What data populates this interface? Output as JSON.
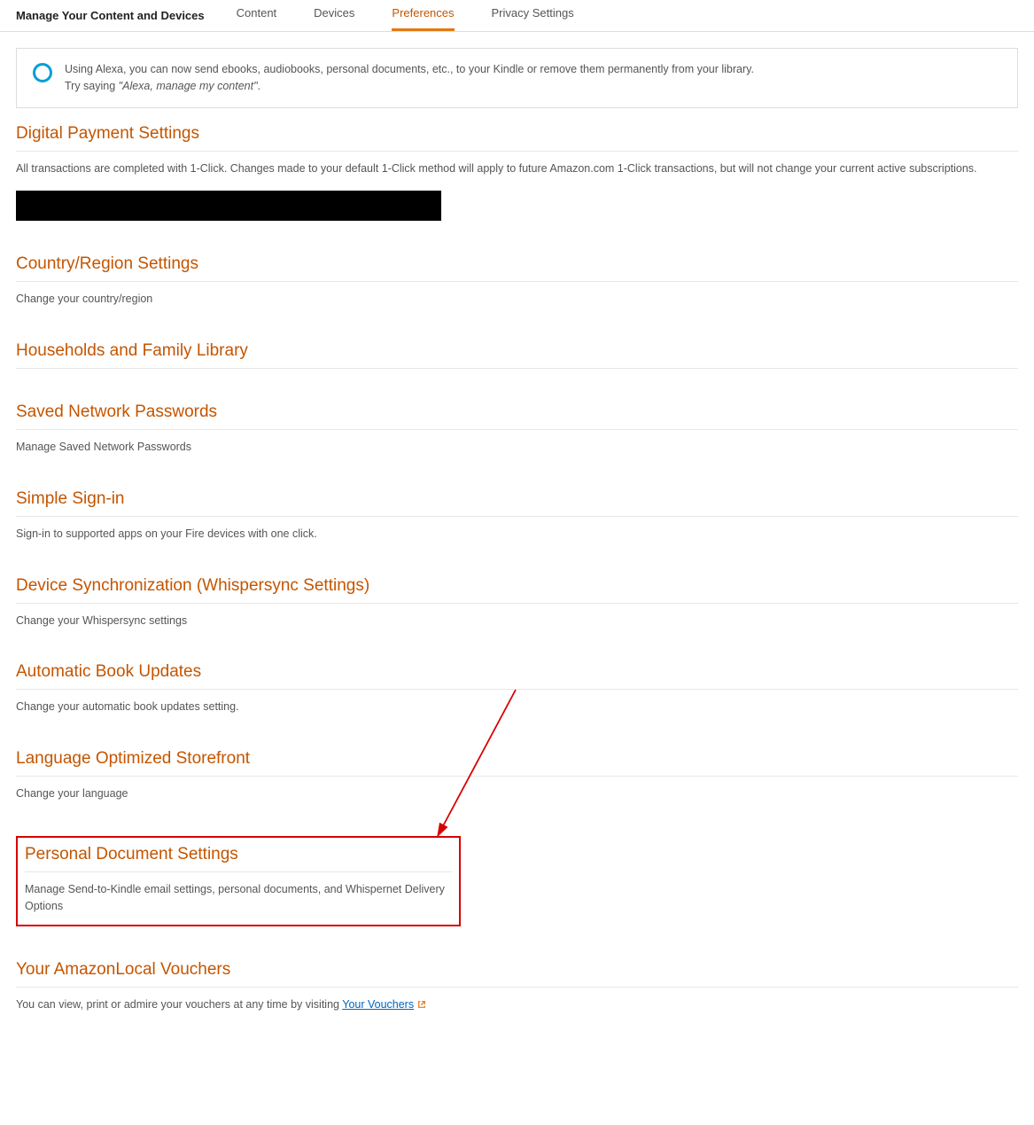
{
  "header": {
    "title": "Manage Your Content and Devices",
    "tabs": [
      {
        "label": "Content",
        "active": false
      },
      {
        "label": "Devices",
        "active": false
      },
      {
        "label": "Preferences",
        "active": true
      },
      {
        "label": "Privacy Settings",
        "active": false
      }
    ]
  },
  "alexa_banner": {
    "line1": "Using Alexa, you can now send ebooks, audiobooks, personal documents, etc., to your Kindle or remove them permanently from your library.",
    "line2a": "Try saying ",
    "line2b": "\"Alexa, manage my content\"",
    "line2c": "."
  },
  "sections": {
    "digital_payment": {
      "heading": "Digital Payment Settings",
      "desc": "All transactions are completed with 1-Click. Changes made to your default 1-Click method will apply to future Amazon.com 1-Click transactions, but will not change your current active subscriptions."
    },
    "country": {
      "heading": "Country/Region Settings",
      "desc": "Change your country/region"
    },
    "households": {
      "heading": "Households and Family Library"
    },
    "saved_network": {
      "heading": "Saved Network Passwords",
      "desc": "Manage Saved Network Passwords"
    },
    "simple_signin": {
      "heading": "Simple Sign-in",
      "desc": "Sign-in to supported apps on your Fire devices with one click."
    },
    "whispersync": {
      "heading": "Device Synchronization (Whispersync Settings)",
      "desc": "Change your Whispersync settings"
    },
    "auto_book": {
      "heading": "Automatic Book Updates",
      "desc": "Change your automatic book updates setting."
    },
    "language_store": {
      "heading": "Language Optimized Storefront",
      "desc": "Change your language"
    },
    "personal_doc": {
      "heading": "Personal Document Settings",
      "desc": "Manage Send-to-Kindle email settings, personal documents, and Whispernet Delivery Options"
    },
    "vouchers": {
      "heading": "Your AmazonLocal Vouchers",
      "desc_a": "You can view, print or admire your vouchers at any time by visiting ",
      "link": "Your Vouchers"
    }
  }
}
